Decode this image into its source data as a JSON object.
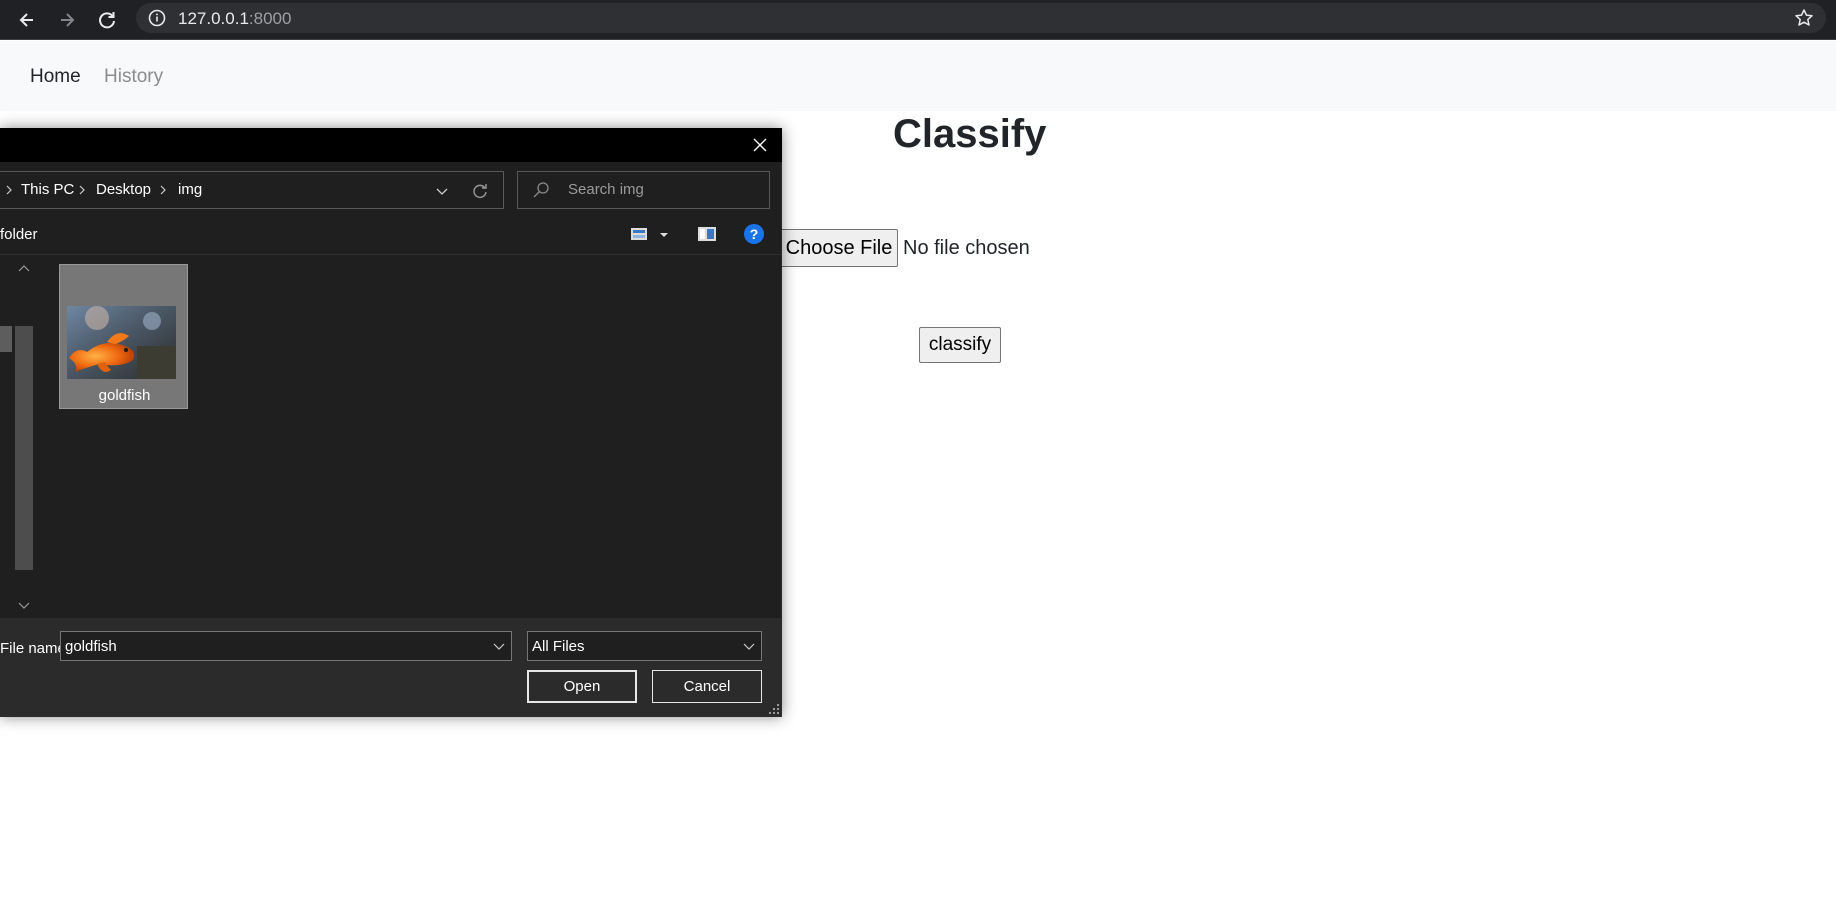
{
  "browser": {
    "url_host": "127.0.0.1",
    "url_port": ":8000",
    "icons": [
      "back-arrow-icon",
      "forward-arrow-icon",
      "reload-icon",
      "info-icon",
      "star-icon"
    ]
  },
  "navbar": {
    "home": "Home",
    "history": "History"
  },
  "main": {
    "title": "Classify",
    "file_button": "Choose File",
    "file_status": "No file chosen",
    "classify_button": "classify"
  },
  "dialog": {
    "breadcrumb": [
      "This PC",
      "Desktop",
      "img"
    ],
    "search_placeholder": "Search img",
    "toolbar_label": "folder",
    "help_label": "?",
    "files": [
      {
        "name": "goldfish"
      }
    ],
    "filename_label": "File name:",
    "filename_value": "goldfish",
    "filetype_value": "All Files",
    "open_button": "Open",
    "cancel_button": "Cancel"
  },
  "colors": {
    "browser_chrome": "#202124",
    "dialog_bg": "#1f1f1f",
    "help_blue": "#1a73e8"
  }
}
